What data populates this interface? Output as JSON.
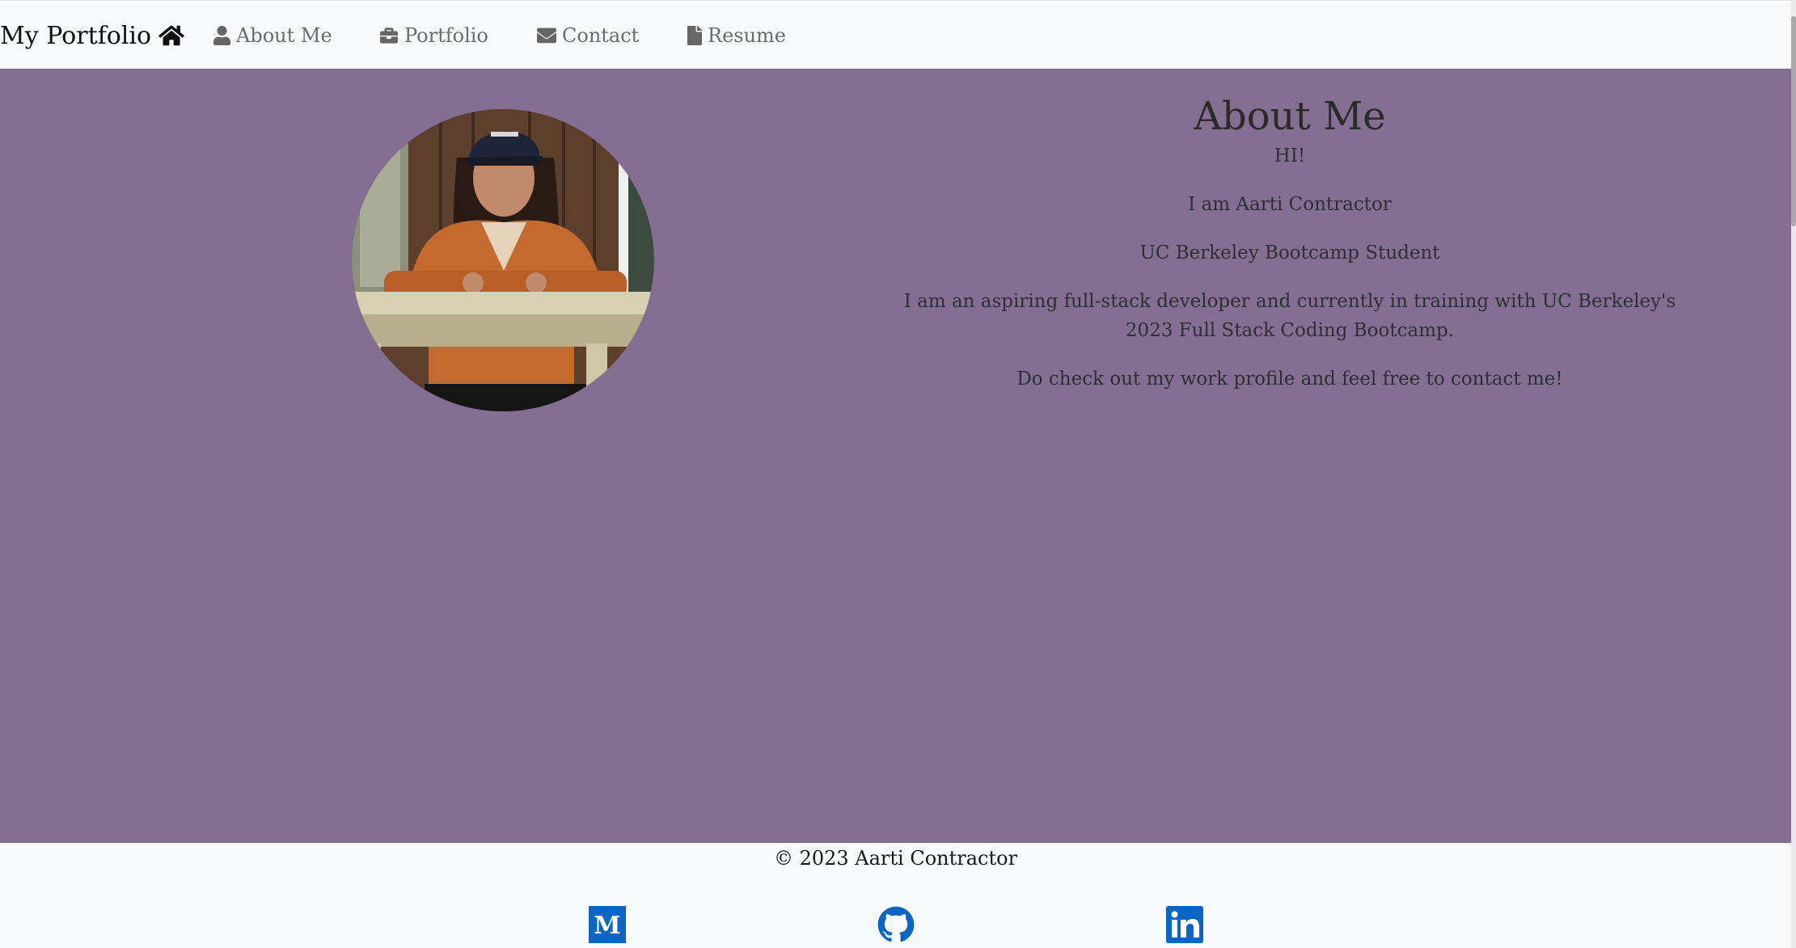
{
  "navbar": {
    "brand": "My Portfolio",
    "items": [
      {
        "label": "About Me",
        "icon": "user-icon"
      },
      {
        "label": "Portfolio",
        "icon": "briefcase-icon"
      },
      {
        "label": "Contact",
        "icon": "envelope-icon"
      },
      {
        "label": "Resume",
        "icon": "file-icon"
      }
    ]
  },
  "about": {
    "heading": "About Me",
    "greeting": "HI!",
    "name_line": "I am Aarti Contractor",
    "role_line": "UC Berkeley Bootcamp Student",
    "bio": "I am an aspiring full-stack developer and currently in training with UC Berkeley's 2023 Full Stack Coding Bootcamp.",
    "cta": "Do check out my work profile and feel free to contact me!"
  },
  "footer": {
    "copyright": "© 2023 Aarti Contractor",
    "social": [
      {
        "icon": "medium-icon"
      },
      {
        "icon": "github-icon"
      },
      {
        "icon": "linkedin-icon"
      }
    ]
  },
  "colors": {
    "accent": "#846f93",
    "nav_bg": "#f8f9fa",
    "social_blue": "#0a66c2"
  }
}
